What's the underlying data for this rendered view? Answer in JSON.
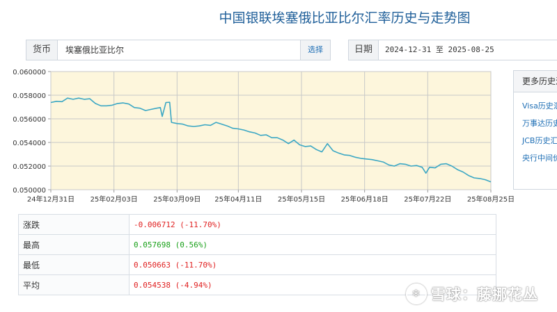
{
  "page": {
    "title": "中国银联埃塞俄比亚比尔汇率历史与走势图"
  },
  "currency_box": {
    "label": "货币",
    "value": "埃塞俄比亚比尔",
    "button": "选择"
  },
  "date_box": {
    "label": "日期",
    "start": "2024-12-31",
    "sep": "至",
    "end": "2025-08-25"
  },
  "side_panel": {
    "header": "更多历史汇率",
    "links": [
      "Visa历史汇率",
      "万事达历史汇率",
      "JCB历史汇率",
      "央行中间价"
    ]
  },
  "stats": {
    "rows": [
      {
        "label": "涨跌",
        "value": "-0.006712 (-11.70%)",
        "tone": "neg"
      },
      {
        "label": "最高",
        "value": "0.057698 (0.56%)",
        "tone": "pos"
      },
      {
        "label": "最低",
        "value": "0.050663 (-11.70%)",
        "tone": "neg"
      },
      {
        "label": "平均",
        "value": "0.054538 (-4.94%)",
        "tone": "neg"
      }
    ]
  },
  "watermark": {
    "logo": "❄",
    "text": "雪球：藤挪花丛"
  },
  "colors": {
    "line": "#3aa7c4",
    "plot_bg": "#fdf6dc",
    "grid": "#c8c8c8"
  },
  "chart_data": {
    "type": "line",
    "title": "",
    "xlabel": "",
    "ylabel": "",
    "ylim": [
      0.05,
      0.06
    ],
    "yticks": [
      0.05,
      0.052,
      0.054,
      0.056,
      0.058,
      0.06
    ],
    "ytick_labels": [
      "0.050000",
      "0.052000",
      "0.054000",
      "0.056000",
      "0.058000",
      "0.060000"
    ],
    "xticks": [
      {
        "date": "2024-12-31",
        "label": "24年12月31日"
      },
      {
        "date": "2025-02-03",
        "label": "25年02月03日"
      },
      {
        "date": "2025-03-09",
        "label": "25年03月09日"
      },
      {
        "date": "2025-04-11",
        "label": "25年04月11日"
      },
      {
        "date": "2025-05-15",
        "label": "25年05月15日"
      },
      {
        "date": "2025-06-18",
        "label": "25年06月18日"
      },
      {
        "date": "2025-07-22",
        "label": "25年07月22日"
      },
      {
        "date": "2025-08-25",
        "label": "25年08月25日"
      }
    ],
    "grid": true,
    "legend": "none",
    "series": [
      {
        "points": [
          [
            "2024-12-31",
            0.05738
          ],
          [
            "2025-01-03",
            0.05748
          ],
          [
            "2025-01-06",
            0.05745
          ],
          [
            "2025-01-09",
            0.05775
          ],
          [
            "2025-01-12",
            0.05765
          ],
          [
            "2025-01-15",
            0.05775
          ],
          [
            "2025-01-18",
            0.05765
          ],
          [
            "2025-01-21",
            0.0577
          ],
          [
            "2025-01-24",
            0.0573
          ],
          [
            "2025-01-27",
            0.0571
          ],
          [
            "2025-01-30",
            0.0571
          ],
          [
            "2025-02-02",
            0.05715
          ],
          [
            "2025-02-05",
            0.0573
          ],
          [
            "2025-02-08",
            0.05735
          ],
          [
            "2025-02-11",
            0.05725
          ],
          [
            "2025-02-14",
            0.05695
          ],
          [
            "2025-02-17",
            0.0569
          ],
          [
            "2025-02-20",
            0.0567
          ],
          [
            "2025-02-23",
            0.0568
          ],
          [
            "2025-02-26",
            0.0569
          ],
          [
            "2025-02-28",
            0.05695
          ],
          [
            "2025-03-01",
            0.0562
          ],
          [
            "2025-03-03",
            0.05738
          ],
          [
            "2025-03-05",
            0.0574
          ],
          [
            "2025-03-06",
            0.0557
          ],
          [
            "2025-03-09",
            0.0556
          ],
          [
            "2025-03-12",
            0.05555
          ],
          [
            "2025-03-15",
            0.0554
          ],
          [
            "2025-03-18",
            0.05535
          ],
          [
            "2025-03-21",
            0.0554
          ],
          [
            "2025-03-24",
            0.0555
          ],
          [
            "2025-03-27",
            0.05545
          ],
          [
            "2025-03-30",
            0.0557
          ],
          [
            "2025-04-02",
            0.05555
          ],
          [
            "2025-04-05",
            0.0554
          ],
          [
            "2025-04-08",
            0.0552
          ],
          [
            "2025-04-11",
            0.05515
          ],
          [
            "2025-04-14",
            0.05505
          ],
          [
            "2025-04-17",
            0.0549
          ],
          [
            "2025-04-20",
            0.0548
          ],
          [
            "2025-04-23",
            0.0546
          ],
          [
            "2025-04-26",
            0.05465
          ],
          [
            "2025-04-29",
            0.0544
          ],
          [
            "2025-05-02",
            0.0544
          ],
          [
            "2025-05-05",
            0.0542
          ],
          [
            "2025-05-08",
            0.0539
          ],
          [
            "2025-05-11",
            0.0542
          ],
          [
            "2025-05-14",
            0.0538
          ],
          [
            "2025-05-17",
            0.05365
          ],
          [
            "2025-05-20",
            0.0537
          ],
          [
            "2025-05-23",
            0.0534
          ],
          [
            "2025-05-26",
            0.0532
          ],
          [
            "2025-05-29",
            0.0539
          ],
          [
            "2025-06-01",
            0.0533
          ],
          [
            "2025-06-04",
            0.0531
          ],
          [
            "2025-06-07",
            0.05295
          ],
          [
            "2025-06-10",
            0.0529
          ],
          [
            "2025-06-13",
            0.05275
          ],
          [
            "2025-06-16",
            0.05265
          ],
          [
            "2025-06-19",
            0.0526
          ],
          [
            "2025-06-22",
            0.05255
          ],
          [
            "2025-06-25",
            0.05245
          ],
          [
            "2025-06-28",
            0.05235
          ],
          [
            "2025-07-01",
            0.0521
          ],
          [
            "2025-07-04",
            0.052
          ],
          [
            "2025-07-07",
            0.0522
          ],
          [
            "2025-07-10",
            0.05215
          ],
          [
            "2025-07-13",
            0.052
          ],
          [
            "2025-07-16",
            0.05205
          ],
          [
            "2025-07-19",
            0.0519
          ],
          [
            "2025-07-21",
            0.0514
          ],
          [
            "2025-07-23",
            0.0519
          ],
          [
            "2025-07-26",
            0.05185
          ],
          [
            "2025-07-29",
            0.05215
          ],
          [
            "2025-08-01",
            0.0522
          ],
          [
            "2025-08-04",
            0.052
          ],
          [
            "2025-08-07",
            0.0517
          ],
          [
            "2025-08-10",
            0.0515
          ],
          [
            "2025-08-13",
            0.0512
          ],
          [
            "2025-08-16",
            0.051
          ],
          [
            "2025-08-19",
            0.05095
          ],
          [
            "2025-08-22",
            0.05085
          ],
          [
            "2025-08-25",
            0.05066
          ]
        ]
      }
    ]
  }
}
